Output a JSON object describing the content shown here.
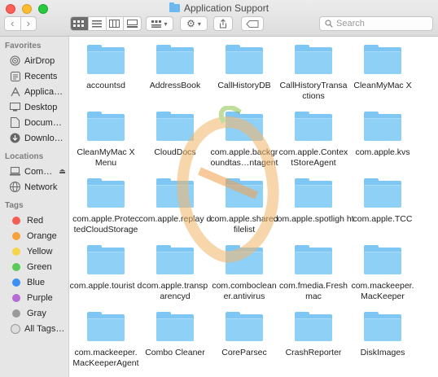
{
  "window": {
    "title": "Application Support"
  },
  "toolbar": {
    "back_icon": "chevron-left-icon",
    "forward_icon": "chevron-right-icon",
    "search_placeholder": "Search"
  },
  "sidebar": {
    "favorites_header": "Favorites",
    "favorites": [
      {
        "label": "AirDrop",
        "icon": "airdrop-icon"
      },
      {
        "label": "Recents",
        "icon": "recents-icon"
      },
      {
        "label": "Applica…",
        "icon": "applications-icon"
      },
      {
        "label": "Desktop",
        "icon": "desktop-icon"
      },
      {
        "label": "Docum…",
        "icon": "documents-icon"
      },
      {
        "label": "Downlo…",
        "icon": "downloads-icon"
      }
    ],
    "locations_header": "Locations",
    "locations": [
      {
        "label": "Com…",
        "icon": "computer-icon"
      },
      {
        "label": "Network",
        "icon": "network-icon"
      }
    ],
    "tags_header": "Tags",
    "tags": [
      {
        "label": "Red",
        "color": "#f25d54"
      },
      {
        "label": "Orange",
        "color": "#f7a13a"
      },
      {
        "label": "Yellow",
        "color": "#f7d54a"
      },
      {
        "label": "Green",
        "color": "#5bc95a"
      },
      {
        "label": "Blue",
        "color": "#3d8ff3"
      },
      {
        "label": "Purple",
        "color": "#b46bd6"
      },
      {
        "label": "Gray",
        "color": "#9a9a9a"
      }
    ],
    "all_tags": "All Tags…"
  },
  "folders": [
    "accountsd",
    "AddressBook",
    "CallHistoryDB",
    "CallHistoryTransa ctions",
    "CleanMyMac X",
    "CleanMyMac X Menu",
    "CloudDocs",
    "com.apple.backgr oundtas…ntagent",
    "com.apple.Contex tStoreAgent",
    "com.apple.kvs",
    "com.apple.Protec tedCloudStorage",
    "com.apple.replay d",
    "com.apple.shared filelist",
    "com.apple.spotligh ht",
    "com.apple.TCC",
    "com.apple.tourist d",
    "com.apple.transp arencyd",
    "com.comboclean er.antivirus",
    "com.fmedia.Fresh mac",
    "com.mackeeper. MacKeeper",
    "com.mackeeper. MacKeeperAgent",
    "Combo Cleaner",
    "CoreParsec",
    "CrashReporter",
    "DiskImages"
  ]
}
